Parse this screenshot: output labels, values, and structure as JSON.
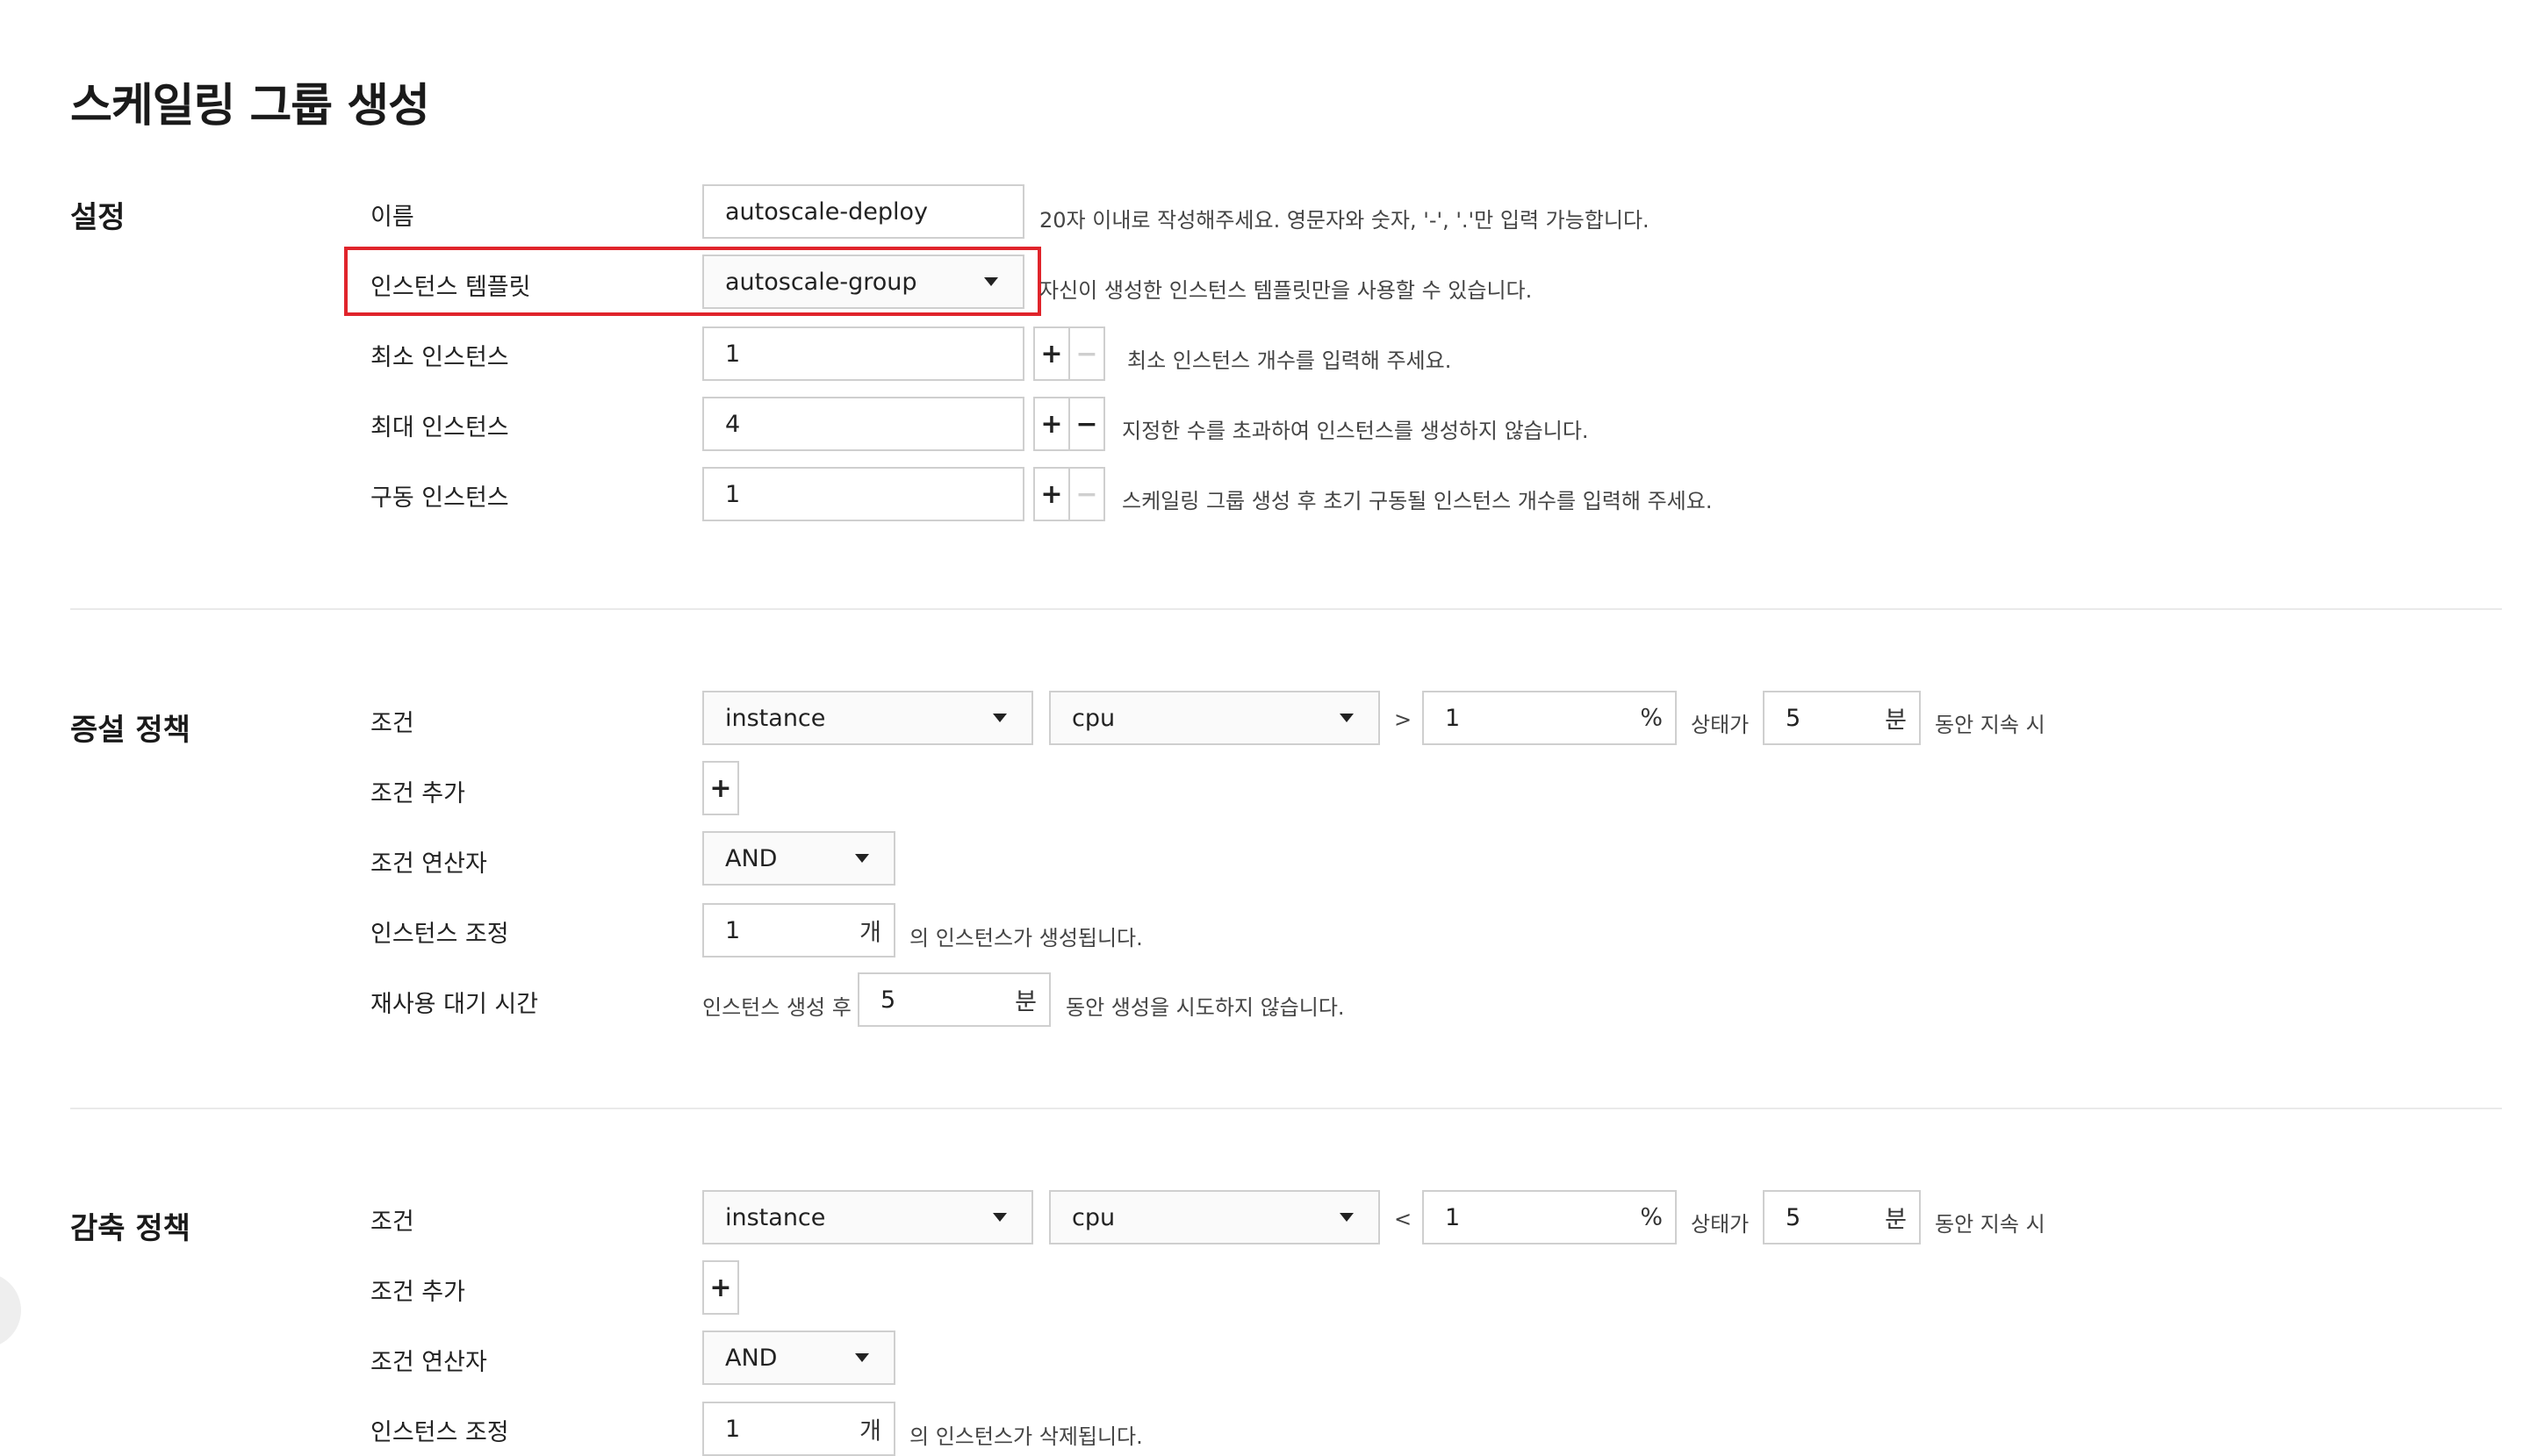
{
  "page": {
    "title": "스케일링 그룹 생성"
  },
  "settings": {
    "section_title": "설정",
    "name": {
      "label": "이름",
      "value": "autoscale-deploy",
      "help": "20자 이내로 작성해주세요. 영문자와 숫자, '-', '.'만 입력 가능합니다."
    },
    "template": {
      "label": "인스턴스 템플릿",
      "value": "autoscale-group",
      "help": "자신이 생성한 인스턴스 템플릿만을 사용할 수 있습니다."
    },
    "min": {
      "label": "최소 인스턴스",
      "value": "1",
      "help": "최소 인스턴스 개수를 입력해 주세요."
    },
    "max": {
      "label": "최대 인스턴스",
      "value": "4",
      "help": "지정한 수를 초과하여 인스턴스를 생성하지 않습니다."
    },
    "running": {
      "label": "구동 인스턴스",
      "value": "1",
      "help": "스케일링 그룹 생성 후 초기 구동될 인스턴스 개수를 입력해 주세요."
    },
    "plus": "+",
    "minus": "−"
  },
  "scale_out": {
    "section_title": "증설 정책",
    "condition_label": "조건",
    "target": "instance",
    "metric": "cpu",
    "operator": ">",
    "threshold": "1",
    "threshold_unit": "%",
    "state_text": "상태가",
    "duration": "5",
    "duration_unit": "분",
    "duration_suffix": "동안 지속 시",
    "add_condition_label": "조건 추가",
    "add_button": "+",
    "logic_label": "조건 연산자",
    "logic_value": "AND",
    "adjust_label": "인스턴스 조정",
    "adjust_value": "1",
    "adjust_unit": "개",
    "adjust_suffix": "의 인스턴스가 생성됩니다.",
    "cooldown_label": "재사용 대기 시간",
    "cooldown_prefix": "인스턴스 생성 후",
    "cooldown_value": "5",
    "cooldown_unit": "분",
    "cooldown_suffix": "동안 생성을 시도하지 않습니다."
  },
  "scale_in": {
    "section_title": "감축 정책",
    "condition_label": "조건",
    "target": "instance",
    "metric": "cpu",
    "operator": "<",
    "threshold": "1",
    "threshold_unit": "%",
    "state_text": "상태가",
    "duration": "5",
    "duration_unit": "분",
    "duration_suffix": "동안 지속 시",
    "add_condition_label": "조건 추가",
    "add_button": "+",
    "logic_label": "조건 연산자",
    "logic_value": "AND",
    "adjust_label": "인스턴스 조정",
    "adjust_value": "1",
    "adjust_unit": "개",
    "adjust_suffix": "의 인스턴스가 삭제됩니다."
  },
  "colors": {
    "highlight": "#e0242b",
    "border": "#cfcfcf",
    "divider": "#e9e9e9"
  },
  "icons": {
    "dropdown": "caret-down-icon"
  }
}
